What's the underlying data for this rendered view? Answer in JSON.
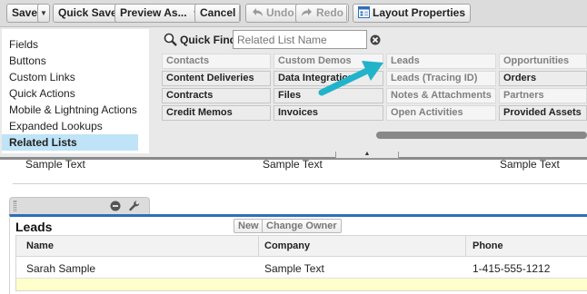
{
  "toolbar": {
    "save": "Save",
    "quick_save": "Quick Save",
    "preview_as": "Preview As...",
    "cancel": "Cancel",
    "undo": "Undo",
    "redo": "Redo",
    "layout_properties": "Layout Properties"
  },
  "palette": {
    "categories": [
      "Fields",
      "Buttons",
      "Custom Links",
      "Quick Actions",
      "Mobile & Lightning Actions",
      "Expanded Lookups",
      "Related Lists"
    ],
    "active_category": "Related Lists",
    "quick_find": {
      "label": "Quick Find",
      "placeholder": "Related List Name"
    },
    "items": [
      {
        "label": "Contacts",
        "used": true
      },
      {
        "label": "Custom Demos",
        "used": true
      },
      {
        "label": "Leads",
        "used": true
      },
      {
        "label": "Opportunities",
        "used": true
      },
      {
        "label": "Content Deliveries",
        "used": false
      },
      {
        "label": "Data Integration",
        "used": false
      },
      {
        "label": "Leads (Tracing ID)",
        "used": true
      },
      {
        "label": "Orders",
        "used": false
      },
      {
        "label": "Contracts",
        "used": false
      },
      {
        "label": "Files",
        "used": false
      },
      {
        "label": "Notes & Attachments",
        "used": true
      },
      {
        "label": "Partners",
        "used": true
      },
      {
        "label": "Credit Memos",
        "used": false
      },
      {
        "label": "Invoices",
        "used": false
      },
      {
        "label": "Open Activities",
        "used": true
      },
      {
        "label": "Provided Assets",
        "used": false
      }
    ]
  },
  "layout": {
    "sample_row": [
      "Sample Text",
      "Sample Text",
      "Sample Text"
    ],
    "related_list": {
      "title": "Leads",
      "buttons": [
        "New",
        "Change Owner"
      ],
      "columns": [
        "Name",
        "Company",
        "Phone"
      ],
      "row": [
        "Sarah Sample",
        "Sample Text",
        "1-415-555-1212"
      ]
    }
  },
  "colors": {
    "accent": "#2f6eb8",
    "arrow": "#21b3c9",
    "highlight_row": "#ffffcc",
    "active_category": "#bfe3f7"
  }
}
